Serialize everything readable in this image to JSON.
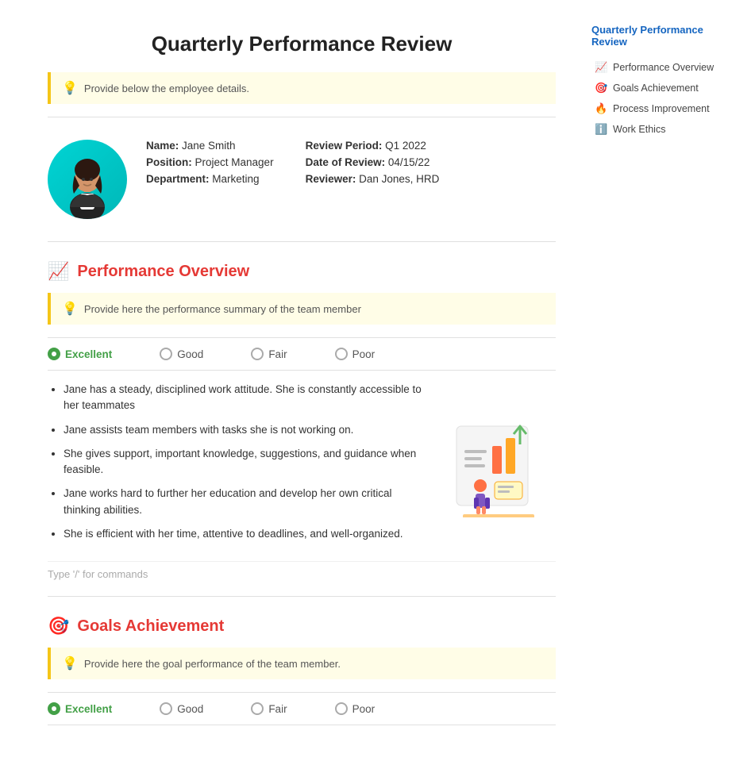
{
  "page": {
    "title": "Quarterly Performance Review"
  },
  "hint": {
    "employee_hint": "Provide below the employee details.",
    "performance_hint": "Provide here the performance summary of the team member",
    "goals_hint": "Provide here the goal performance of the team member."
  },
  "employee": {
    "name_label": "Name:",
    "name_value": "Jane Smith",
    "position_label": "Position:",
    "position_value": "Project Manager",
    "department_label": "Department:",
    "department_value": "Marketing",
    "review_period_label": "Review Period:",
    "review_period_value": "Q1 2022",
    "date_label": "Date of Review:",
    "date_value": "04/15/22",
    "reviewer_label": "Reviewer:",
    "reviewer_value": "Dan Jones, HRD"
  },
  "sections": {
    "performance": {
      "title": "Performance Overview",
      "icon": "📈"
    },
    "goals": {
      "title": "Goals Achievement",
      "icon": "🎯"
    }
  },
  "ratings": [
    {
      "label": "Excellent",
      "checked": true,
      "class": "excellent"
    },
    {
      "label": "Good",
      "checked": false,
      "class": "good"
    },
    {
      "label": "Fair",
      "checked": false,
      "class": "fair"
    },
    {
      "label": "Poor",
      "checked": false,
      "class": "poor"
    }
  ],
  "bullets": [
    "Jane has a steady, disciplined work attitude. She is constantly accessible to her teammates",
    "Jane assists team members with tasks she is not working on.",
    "She gives support, important knowledge, suggestions, and guidance when feasible.",
    "Jane works hard to further her education and develop her own critical thinking abilities.",
    "She is efficient with her time, attentive to deadlines, and well-organized."
  ],
  "type_hint": "Type '/' for commands",
  "sidebar": {
    "title": "Quarterly Performance Review",
    "items": [
      {
        "label": "Performance Overview",
        "icon": "📈",
        "color": "#e91e63"
      },
      {
        "label": "Goals Achievement",
        "icon": "🎯",
        "color": "#f44336"
      },
      {
        "label": "Process Improvement",
        "icon": "🔥",
        "color": "#ff9800"
      },
      {
        "label": "Work Ethics",
        "icon": "ℹ️",
        "color": "#9e9e9e"
      }
    ]
  }
}
